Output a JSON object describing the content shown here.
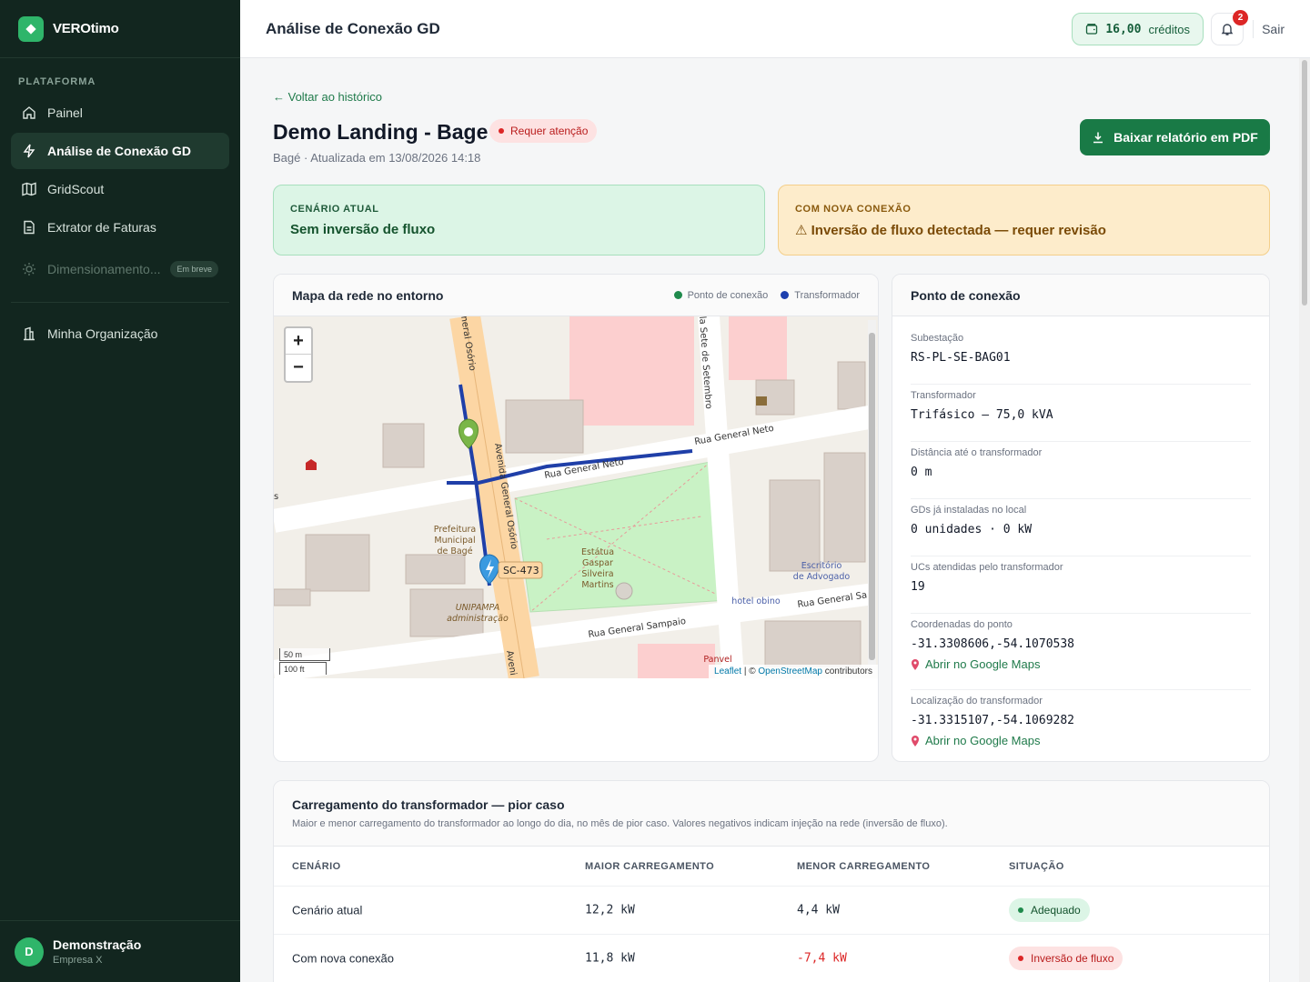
{
  "brand": {
    "name": "VEROtimo"
  },
  "sidebar": {
    "section_heading": "PLATAFORMA",
    "items": [
      {
        "label": "Painel",
        "icon": "home-icon"
      },
      {
        "label": "Análise de Conexão GD",
        "icon": "bolt-icon",
        "active": true
      },
      {
        "label": "GridScout",
        "icon": "map-icon"
      },
      {
        "label": "Extrator de Faturas",
        "icon": "document-icon"
      },
      {
        "label": "Dimensionamento...",
        "icon": "sun-icon",
        "badge": "Em breve",
        "disabled": true
      }
    ],
    "org_item": {
      "label": "Minha Organização",
      "icon": "building-icon"
    },
    "user": {
      "initial": "D",
      "name": "Demonstração",
      "org": "Empresa X"
    }
  },
  "topbar": {
    "title": "Análise de Conexão GD",
    "credits_amount": "16,00",
    "credits_label": "créditos",
    "notifications_count": "2",
    "logout_label": "Sair"
  },
  "page": {
    "back_link": "← Voltar ao histórico",
    "title": "Demo Landing - Bage",
    "status": "Requer atenção",
    "subtitle": "Bagé · Atualizada em 13/08/2026 14:18",
    "pdf_button": "Baixar relatório em PDF"
  },
  "scenarios": {
    "current": {
      "label": "CENÁRIO ATUAL",
      "value": "Sem inversão de fluxo"
    },
    "new": {
      "label": "COM NOVA CONEXÃO",
      "value": "⚠ Inversão de fluxo detectada — requer revisão"
    }
  },
  "map": {
    "title": "Mapa da rede no entorno",
    "legend": [
      {
        "label": "Ponto de conexão",
        "color": "#1f8a4c"
      },
      {
        "label": "Transformador",
        "color": "#1e40af"
      }
    ],
    "zoom_in": "+",
    "zoom_out": "−",
    "scale_m": "50 m",
    "scale_ft": "100 ft",
    "attribution_leaflet": "Leaflet",
    "attribution_osm": "OpenStreetMap",
    "attribution_rest": "| © ",
    "attribution_contrib": " contributors",
    "labels": {
      "street1": "Rua General Neto",
      "street2": "Rua General Neto",
      "street3": "Rua General Sampaio",
      "street4": "Rua General Sa",
      "street5": "Avenida General Osório",
      "street6": "neral Osório",
      "street7": "la Sete de Setembro",
      "street8": "Aveni",
      "road_ref": "SC-473",
      "poi1": "Prefeitura",
      "poi1b": "Municipal",
      "poi1c": "de Bagé",
      "poi2": "Estátua",
      "poi2b": "Gaspar",
      "poi2c": "Silveira",
      "poi2d": "Martins",
      "poi3": "Escritório",
      "poi3b": "de Advogado",
      "poi4": "hotel obino",
      "poi5": "Panvel",
      "poi6": "UNIPAMPA",
      "poi6b": "administração",
      "poi_s": "s"
    }
  },
  "connection": {
    "title": "Ponto de conexão",
    "rows": [
      {
        "label": "Subestação",
        "value": "RS-PL-SE-BAG01"
      },
      {
        "label": "Transformador",
        "value": "Trifásico — 75,0 kVA"
      },
      {
        "label": "Distância até o transformador",
        "value": "0 m"
      },
      {
        "label": "GDs já instaladas no local",
        "value": "0 unidades · 0 kW"
      },
      {
        "label": "UCs atendidas pelo transformador",
        "value": "19"
      },
      {
        "label": "Coordenadas do ponto",
        "value": "-31.3308606,-54.1070538",
        "link": "Abrir no Google Maps"
      },
      {
        "label": "Localização do transformador",
        "value": "-31.3315107,-54.1069282",
        "link": "Abrir no Google Maps"
      }
    ]
  },
  "loading": {
    "title": "Carregamento do transformador — pior caso",
    "description": "Maior e menor carregamento do transformador ao longo do dia, no mês de pior caso. Valores negativos indicam injeção na rede (inversão de fluxo).",
    "columns": [
      "CENÁRIO",
      "MAIOR CARREGAMENTO",
      "MENOR CARREGAMENTO",
      "SITUAÇÃO"
    ],
    "rows": [
      {
        "scenario": "Cenário atual",
        "max": "12,2 kW",
        "min": "4,4 kW",
        "status": "Adequado"
      },
      {
        "scenario": "Com nova conexão",
        "max": "11,8 kW",
        "min": "-7,4 kW",
        "status": "Inversão de fluxo"
      }
    ]
  }
}
